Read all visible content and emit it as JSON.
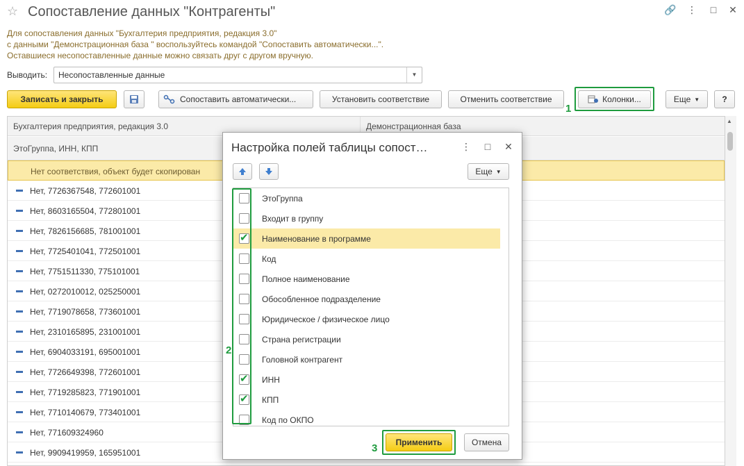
{
  "window": {
    "title": "Сопоставление данных \"Контрагенты\"",
    "controls": [
      "link-icon",
      "more-icon",
      "minimize-icon",
      "maximize-icon",
      "close-icon"
    ]
  },
  "info": {
    "line1": "Для сопоставления данных \"Бухгалтерия предприятия, редакция 3.0\"",
    "line2": "с данными \"Демонстрационная база \" воспользуйтесь командой \"Сопоставить автоматически...\".",
    "line3": "Оставшиеся несопоставленные данные можно связать друг с другом вручную."
  },
  "filter": {
    "label": "Выводить:",
    "value": "Несопоставленные данные"
  },
  "toolbar": {
    "save_close": "Записать и закрыть",
    "auto_match": "Сопоставить автоматически...",
    "set_match": "Установить соответствие",
    "cancel_match": "Отменить соответствие",
    "columns": "Колонки...",
    "more": "Еще",
    "help": "?"
  },
  "callouts": [
    "1",
    "2",
    "3"
  ],
  "table": {
    "col_left": "Бухгалтерия предприятия, редакция 3.0",
    "col_right": "Демонстрационная база",
    "subheader": "ЭтоГруппа, ИНН, КПП",
    "selected_row": "Нет соответствия, объект будет скопирован",
    "rows": [
      "Нет, 7726367548, 772601001",
      "Нет, 8603165504, 772801001",
      "Нет, 7826156685, 781001001",
      "Нет, 7725401041, 772501001",
      "Нет, 7751511330, 775101001",
      "Нет, 0272010012, 025250001",
      "Нет, 7719078658, 773601001",
      "Нет, 2310165895, 231001001",
      "Нет, 6904033191, 695001001",
      "Нет, 7726649398, 772601001",
      "Нет, 7719285823, 771901001",
      "Нет, 7710140679, 773401001",
      "Нет, 771609324960",
      "Нет, 9909419959, 165951001"
    ]
  },
  "dialog": {
    "title": "Настройка полей таблицы сопост…",
    "more": "Еще",
    "apply": "Применить",
    "cancel": "Отмена",
    "fields": [
      {
        "label": "ЭтоГруппа",
        "checked": false
      },
      {
        "label": "Входит в группу",
        "checked": false
      },
      {
        "label": "Наименование в программе",
        "checked": true
      },
      {
        "label": "Код",
        "checked": false
      },
      {
        "label": "Полное наименование",
        "checked": false
      },
      {
        "label": "Обособленное подразделение",
        "checked": false
      },
      {
        "label": "Юридическое / физическое лицо",
        "checked": false
      },
      {
        "label": "Страна регистрации",
        "checked": false
      },
      {
        "label": "Головной контрагент",
        "checked": false
      },
      {
        "label": "ИНН",
        "checked": true
      },
      {
        "label": "КПП",
        "checked": true
      },
      {
        "label": "Код по ОКПО",
        "checked": false
      }
    ]
  },
  "colors": {
    "accent_yellow": "#f4cc14",
    "highlight_green": "#1e9b3e",
    "selection": "#fbeaa8"
  }
}
